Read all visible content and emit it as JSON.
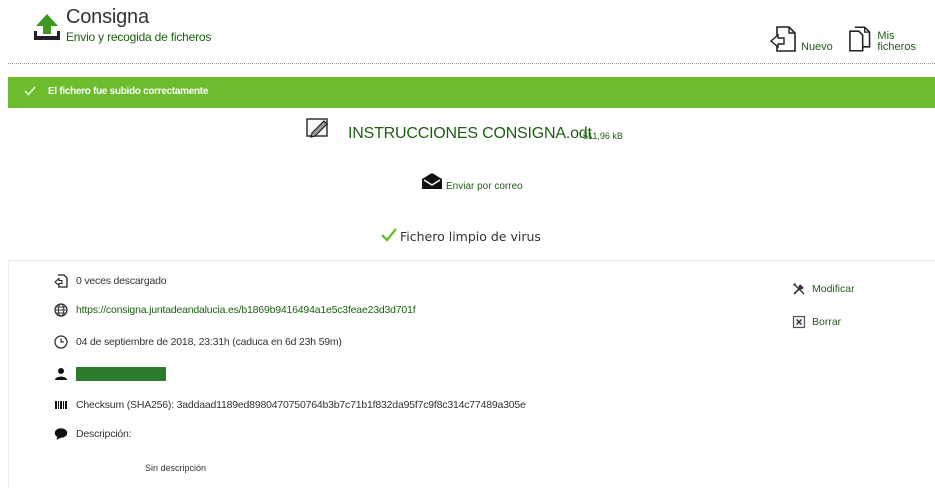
{
  "header": {
    "title": "Consigna",
    "subtitle": "Envio y recogida de ficheros",
    "actions": {
      "nuevo_label": "Nuevo",
      "mis_ficheros_label": "Mis ficheros"
    }
  },
  "alert": {
    "message": "El fichero fue subido correctamente"
  },
  "file": {
    "name": "INSTRUCCIONES CONSIGNA.odt",
    "size": "511,96 kB",
    "send_email_label": "Enviar por correo",
    "virus_status": "Fichero limpio de virus"
  },
  "details": {
    "downloads": "0 veces descargado",
    "link": "https://consigna.juntadeandalucia.es/b1869b9416494a1e5c3feae23d3d701f",
    "date": "04 de septiembre de 2018, 23:31h (caduca en 6d 23h 59m)",
    "checksum": "Checksum (SHA256): 3addaad1189ed8980470750764b3b7c71b1f832da95f7c9f8c314c77489a305e",
    "description_label": "Descripción:",
    "description_value": "Sin descripción"
  },
  "side_actions": {
    "modificar_label": "Modificar",
    "borrar_label": "Borrar"
  },
  "colors": {
    "accent_green": "#6dbc2d",
    "text_green": "#1d5f12"
  },
  "icons": {
    "logo": "upload-icon",
    "nuevo": "new-file-icon",
    "mis_ficheros": "files-icon",
    "success": "check-icon",
    "file": "document-edit-icon",
    "mail": "envelope-icon",
    "virus_ok": "check-icon",
    "downloads": "download-arrow-icon",
    "link": "globe-icon",
    "date": "clock-icon",
    "owner": "user-icon",
    "checksum": "barcode-icon",
    "description": "speech-bubble-icon",
    "modificar": "tools-icon",
    "borrar": "delete-icon"
  }
}
